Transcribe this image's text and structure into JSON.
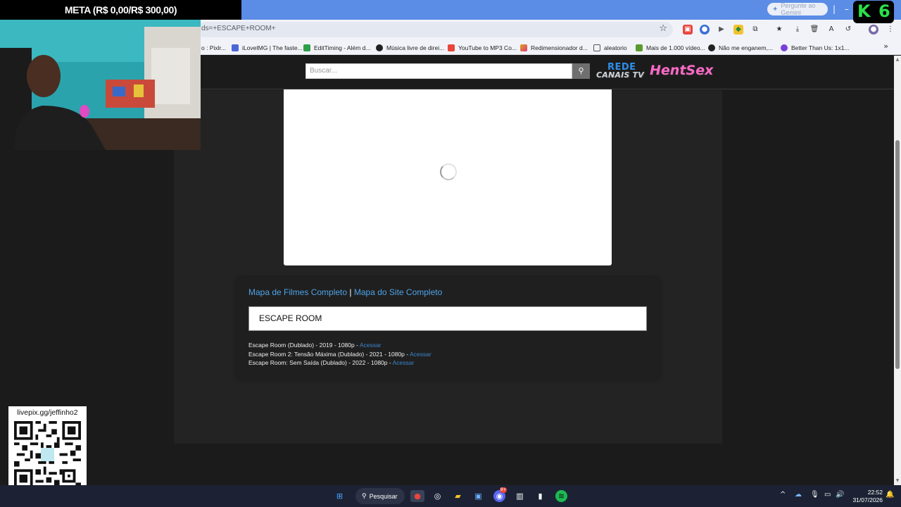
{
  "browser": {
    "gemini_label": "Pergunte ao Gemini",
    "url": "ds=+ESCAPE+ROOM+",
    "bookmarks": [
      {
        "label": "o : Pixlr...",
        "color": "#3f7bd9"
      },
      {
        "label": "iLoveIMG | The faste...",
        "color": "#4a66d8"
      },
      {
        "label": "EditTiming - Além d...",
        "color": "#2e9e4a"
      },
      {
        "label": "Música livre de direi...",
        "color": "#222222"
      },
      {
        "label": "YouTube to MP3 Co...",
        "color": "#e8453c"
      },
      {
        "label": "Redimensionador d...",
        "color": "#e3a21a"
      },
      {
        "label": "aleatorio",
        "color": "#6b6b6b"
      },
      {
        "label": "Mais de 1.000 vídeo...",
        "color": "#5b9a2e"
      },
      {
        "label": "Não me enganem,...",
        "color": "#222222"
      },
      {
        "label": "Better Than Us: 1x1...",
        "color": "#7b3fd9"
      }
    ]
  },
  "site": {
    "search_placeholder": "Buscar...",
    "logo_top": "REDE",
    "logo_bottom": "CANAIS TV",
    "logo_side": "HentSex",
    "map_films": "Mapa de Filmes Completo",
    "separator": "|",
    "map_site": "Mapa do Site Completo",
    "search_title": "ESCAPE ROOM",
    "results": [
      {
        "text": "Escape Room (Dublado) - 2019 - 1080p - ",
        "link": "Acessar"
      },
      {
        "text": "Escape Room 2: Tensão Máxima (Dublado) - 2021 - 1080p - ",
        "link": "Acessar"
      },
      {
        "text": "Escape Room: Sem Saída (Dublado) - 2022 - 1080p - ",
        "link": "Acessar"
      }
    ]
  },
  "overlay": {
    "meta": "META (R$ 0,00/R$ 300,00)",
    "k6_left": "K",
    "k6_right": "6",
    "livepix": "livepix.gg/jeffinho2"
  },
  "taskbar": {
    "search_label": "Pesquisar",
    "discord_badge": "9+",
    "time": "22:52",
    "date": "31/07/2026"
  }
}
